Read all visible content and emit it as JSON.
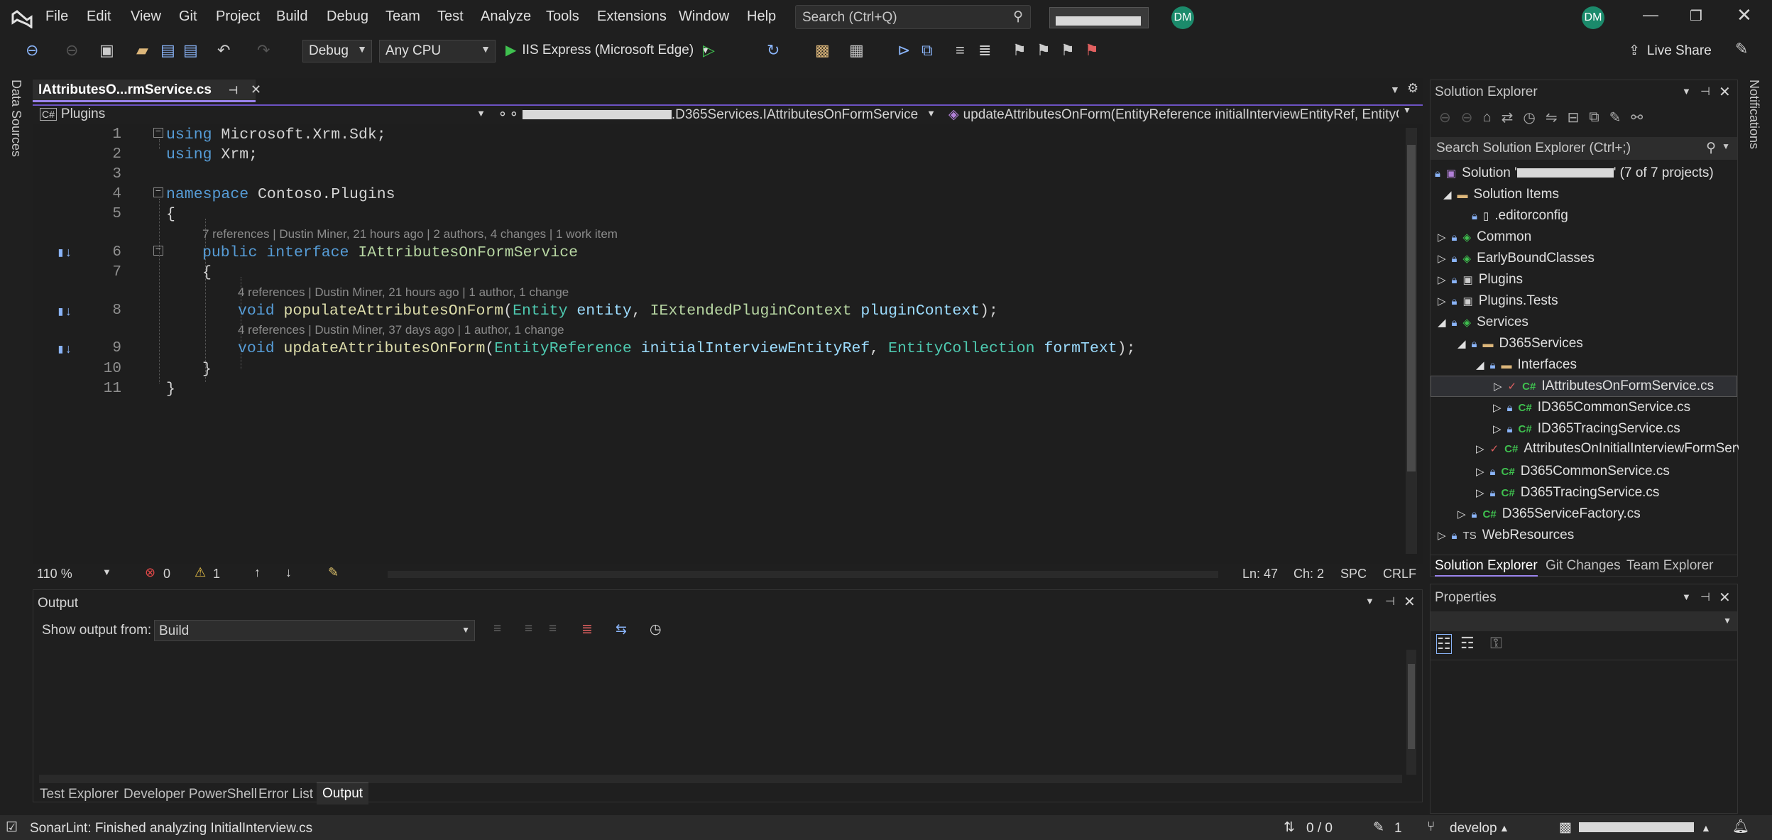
{
  "menu": {
    "items": [
      "File",
      "Edit",
      "View",
      "Git",
      "Project",
      "Build",
      "Debug",
      "Team",
      "Test",
      "Analyze",
      "Tools",
      "Extensions",
      "Window",
      "Help"
    ],
    "search_placeholder": "Search (Ctrl+Q)",
    "user_initials": "DM"
  },
  "toolbar": {
    "configuration": "Debug",
    "platform": "Any CPU",
    "run_target": "IIS Express (Microsoft Edge)",
    "live_share": "Live Share"
  },
  "side_strips": {
    "left": "Data Sources",
    "right": "Notifications"
  },
  "editor": {
    "tab_title": "IAttributesO...rmService.cs",
    "nav_project": "Plugins",
    "nav_type_suffix": ".D365Services.IAttributesOnFormService",
    "nav_member": "updateAttributesOnForm(EntityReference initialInterviewEntityRef, EntityCc",
    "line_numbers": [
      "1",
      "2",
      "3",
      "4",
      "5",
      "6",
      "7",
      "8",
      "9",
      "10",
      "11"
    ],
    "lens": {
      "interface": "7 references | Dustin Miner, 21 hours ago | 2 authors, 4 changes | 1 work item",
      "populate": "4 references | Dustin Miner, 21 hours ago | 1 author, 1 change",
      "update": "4 references | Dustin Miner, 37 days ago | 1 author, 1 change"
    },
    "code": {
      "l1_kw": "using",
      "l1_rest": " Microsoft.Xrm.Sdk;",
      "l2_kw": "using",
      "l2_rest": " Xrm;",
      "l4_kw": "namespace",
      "l4_rest": " Contoso.Plugins",
      "brace_open": "{",
      "brace_close": "}",
      "l6_kw1": "public",
      "l6_kw2": "interface",
      "l6_name": "IAttributesOnFormService",
      "l8_void": "void",
      "l8_fn": "populateAttributesOnForm",
      "l8_t1": "Entity",
      "l8_p1": "entity",
      "l8_t2": "IExtendedPluginContext",
      "l8_p2": "pluginContext",
      "l9_void": "void",
      "l9_fn": "updateAttributesOnForm",
      "l9_t1": "EntityReference",
      "l9_p1": "initialInterviewEntityRef",
      "l9_t2": "EntityCollection",
      "l9_p2": "formText"
    },
    "status": {
      "zoom": "110 %",
      "errors": "0",
      "warnings": "1",
      "line": "Ln: 47",
      "col": "Ch: 2",
      "spc": "SPC",
      "eol": "CRLF"
    }
  },
  "output": {
    "title": "Output",
    "show_from_label": "Show output from:",
    "source": "Build"
  },
  "bottom_tabs": [
    "Test Explorer",
    "Developer PowerShell",
    "Error List",
    "Output"
  ],
  "solution_explorer": {
    "title": "Solution Explorer",
    "search_placeholder": "Search Solution Explorer (Ctrl+;)",
    "solution_prefix": "Solution '",
    "solution_suffix": "' (7 of 7 projects)",
    "items": [
      "Solution Items",
      ".editorconfig",
      "Common",
      "EarlyBoundClasses",
      "Plugins",
      "Plugins.Tests",
      "Services",
      "D365Services",
      "Interfaces",
      "IAttributesOnFormService.cs",
      "ID365CommonService.cs",
      "ID365TracingService.cs",
      "AttributesOnInitialInterviewFormService.cs",
      "D365CommonService.cs",
      "D365TracingService.cs",
      "D365ServiceFactory.cs",
      "WebResources"
    ],
    "tabs": [
      "Solution Explorer",
      "Git Changes",
      "Team Explorer"
    ]
  },
  "properties": {
    "title": "Properties"
  },
  "statusbar": {
    "message": "SonarLint: Finished analyzing InitialInterview.cs",
    "sync": "0 / 0",
    "pending": "1",
    "branch": "develop"
  },
  "colors": {
    "accent": "#9b84ec",
    "keyword": "#569cd6",
    "type": "#4ec9b0",
    "method": "#dcdcaa",
    "param": "#9cdcfe"
  }
}
